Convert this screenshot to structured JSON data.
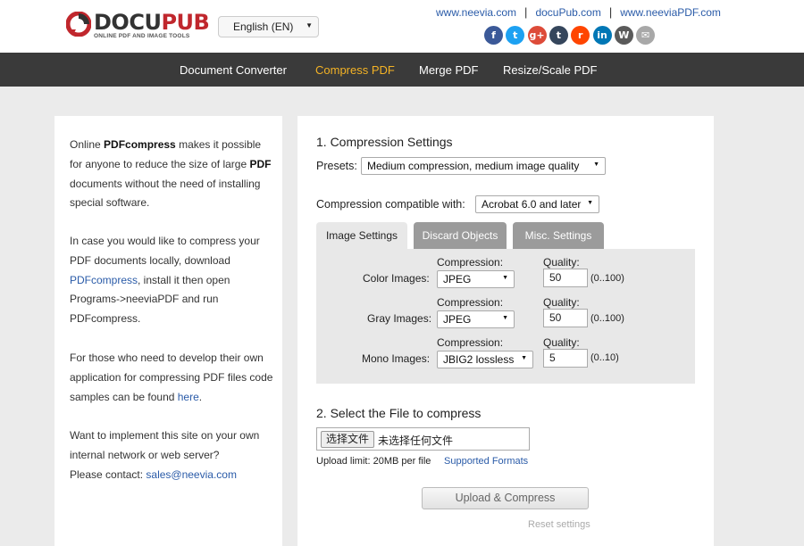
{
  "brand": {
    "name_part1": "DOCU",
    "name_part2": "PUB",
    "tagline": "ONLINE PDF AND IMAGE TOOLS"
  },
  "language": {
    "selected": "English (EN)"
  },
  "top_links": [
    "www.neevia.com",
    "docuPub.com",
    "www.neeviaPDF.com"
  ],
  "social": [
    {
      "icon": "facebook-icon",
      "glyph": "f",
      "color": "#3b5998"
    },
    {
      "icon": "twitter-icon",
      "glyph": "t",
      "color": "#1da1f2"
    },
    {
      "icon": "google-plus-icon",
      "glyph": "g+",
      "color": "#dd4b39"
    },
    {
      "icon": "tumblr-icon",
      "glyph": "t",
      "color": "#35465c"
    },
    {
      "icon": "reddit-icon",
      "glyph": "r",
      "color": "#ff4500"
    },
    {
      "icon": "linkedin-icon",
      "glyph": "in",
      "color": "#0077b5"
    },
    {
      "icon": "wordpress-icon",
      "glyph": "W",
      "color": "#5a5a5a"
    },
    {
      "icon": "email-icon",
      "glyph": "✉",
      "color": "#a8a8a8"
    }
  ],
  "nav": [
    {
      "label": "Document Converter",
      "active": false
    },
    {
      "label": "Compress PDF",
      "active": true
    },
    {
      "label": "Merge PDF",
      "active": false
    },
    {
      "label": "Resize/Scale PDF",
      "active": false
    }
  ],
  "sidebar": {
    "p1_a": "Online ",
    "p1_b": "PDFcompress",
    "p1_c": " makes it possible for anyone to reduce the size of large ",
    "p1_d": "PDF",
    "p1_e": " documents without the need of installing special software.",
    "p2_a": "In case you would like to compress your PDF documents locally, download ",
    "p2_link": "PDFcompress",
    "p2_b": ", install it then open Programs->neeviaPDF and run PDFcompress.",
    "p3_a": "For those who need to develop their own application for compressing PDF files code samples can be found ",
    "p3_link": "here",
    "p3_b": ".",
    "p4_a": "Want to implement this site on your own internal network or web server?",
    "p4_b": "Please contact: ",
    "p4_link": "sales@neevia.com"
  },
  "settings": {
    "title": "1. Compression Settings",
    "presets_label": "Presets:",
    "presets_value": "Medium compression, medium image quality",
    "compat_label": "Compression compatible with:",
    "compat_value": "Acrobat 6.0 and later",
    "tabs": [
      "Image Settings",
      "Discard Objects",
      "Misc. Settings"
    ],
    "compression_label": "Compression:",
    "quality_label": "Quality:",
    "rows": [
      {
        "label": "Color Images:",
        "compression": "JPEG",
        "quality": "50",
        "range": "(0..100)"
      },
      {
        "label": "Gray Images:",
        "compression": "JPEG",
        "quality": "50",
        "range": "(0..100)"
      },
      {
        "label": "Mono Images:",
        "compression": "JBIG2 lossless",
        "quality": "5",
        "range": "(0..10)"
      }
    ]
  },
  "file": {
    "title": "2. Select the File to compress",
    "button": "选择文件",
    "status": "未选择任何文件",
    "limit": "Upload limit: 20MB per file",
    "formats_link": "Supported Formats"
  },
  "actions": {
    "upload": "Upload & Compress",
    "reset": "Reset settings"
  }
}
